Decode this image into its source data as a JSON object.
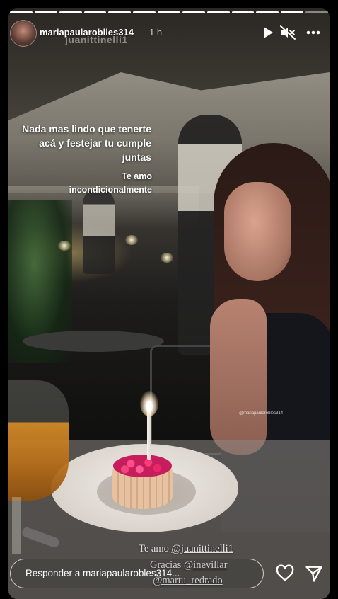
{
  "story": {
    "segments_total": 13,
    "segments_done": 12,
    "username": "mariapaularoblles314",
    "time": "1 h",
    "ghost_tag": "juanittinelli1",
    "caption_main": "Nada mas lindo que tenerte acá y festejar tu cumple juntas",
    "caption_secondary": "Te amo incondicionalmente",
    "watermark": "@mariapaularobles314",
    "mentions": {
      "line1_prefix": "Te amo ",
      "line1_handle": "@juanittinelli1",
      "line2_prefix": "Gracias ",
      "line2_handle": "@inevillar",
      "line3_handle": "@martu_redrado"
    }
  },
  "header_icons": [
    "play-icon",
    "mute-icon",
    "more-icon"
  ],
  "reply": {
    "placeholder": "Responder a mariapaularobles314..."
  },
  "actions": [
    "heart-icon",
    "share-icon"
  ]
}
